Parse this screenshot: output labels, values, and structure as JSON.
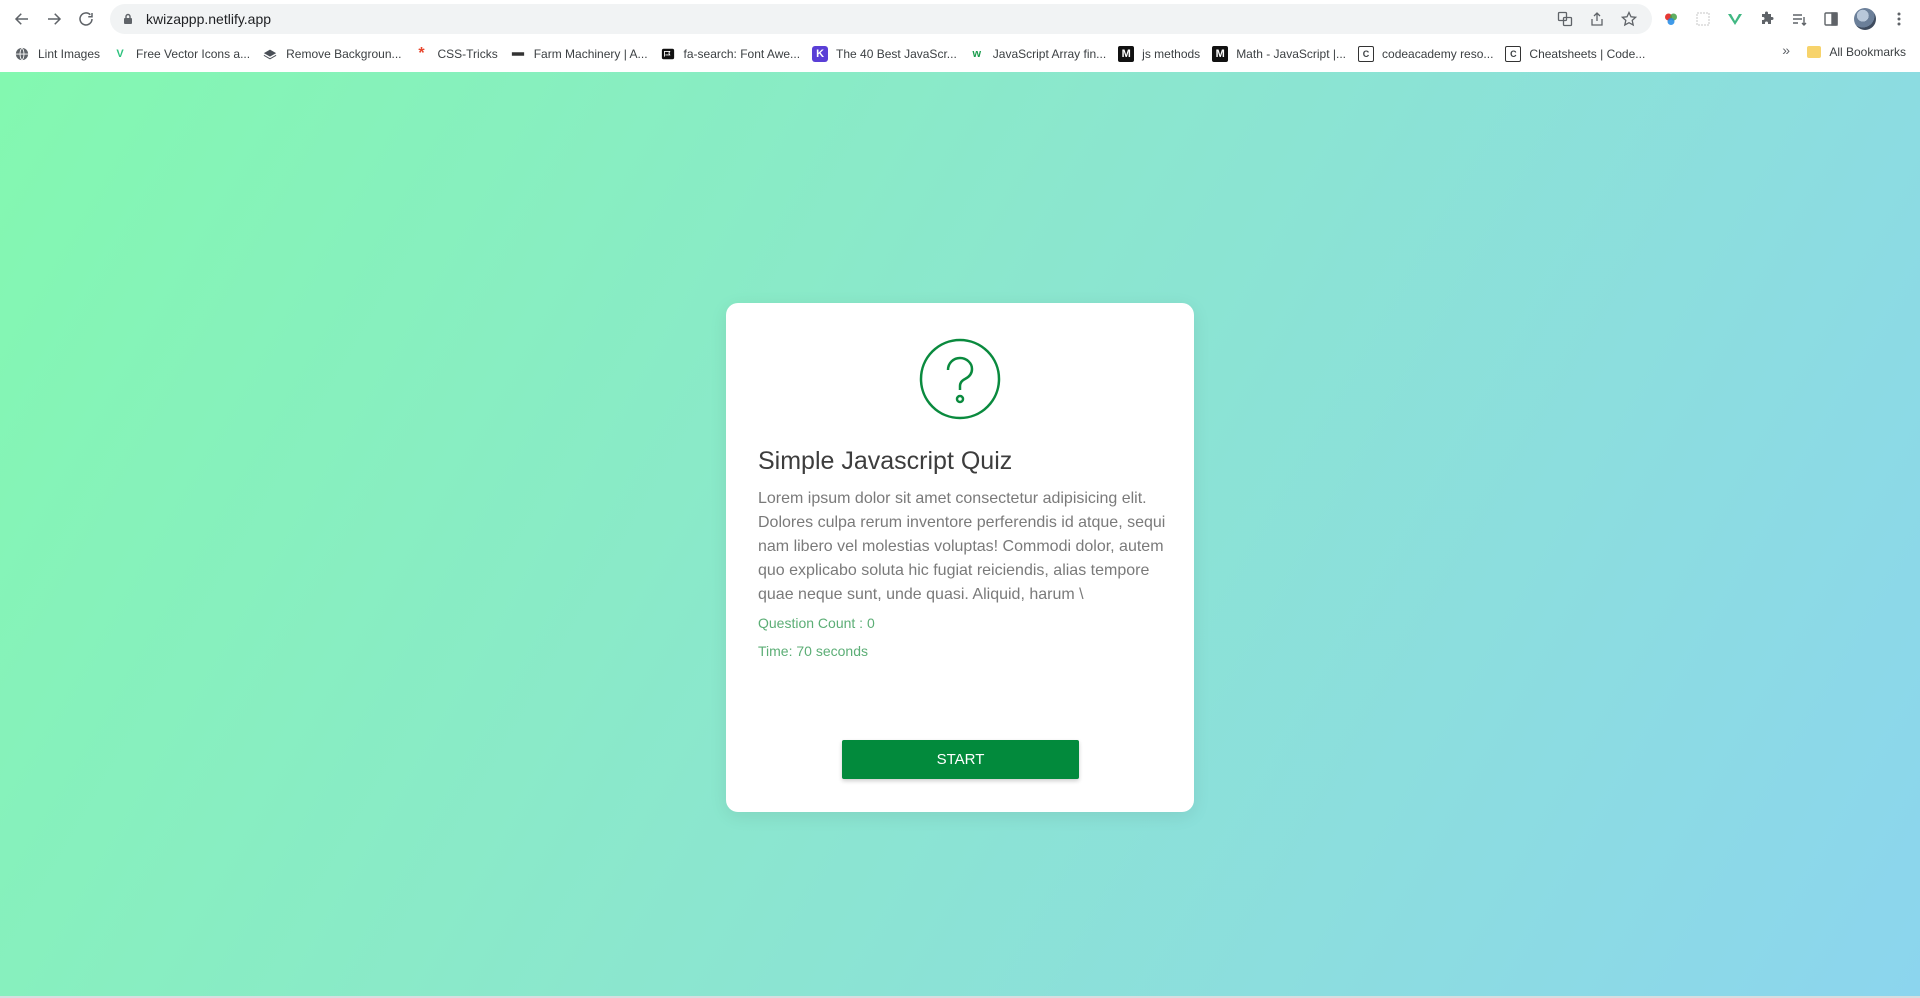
{
  "browser": {
    "url": "kwizappp.netlify.app",
    "nav": {
      "back_icon": "arrow-left-icon",
      "forward_icon": "arrow-right-icon",
      "reload_icon": "reload-icon"
    },
    "bookmarks": [
      {
        "label": "Lint Images",
        "icon": "globe-icon"
      },
      {
        "label": "Free Vector Icons a...",
        "icon": "v-logo-icon"
      },
      {
        "label": "Remove Backgroun...",
        "icon": "layers-icon"
      },
      {
        "label": "CSS-Tricks",
        "icon": "asterisk-icon"
      },
      {
        "label": "Farm Machinery | A...",
        "icon": "tractor-icon"
      },
      {
        "label": "fa-search: Font Awe...",
        "icon": "flag-icon"
      },
      {
        "label": "The 40 Best JavaScr...",
        "icon": "k-logo-icon"
      },
      {
        "label": "JavaScript Array fin...",
        "icon": "w-logo-icon"
      },
      {
        "label": "js methods",
        "icon": "m-logo-icon"
      },
      {
        "label": "Math - JavaScript |...",
        "icon": "m-logo-icon"
      },
      {
        "label": "codeacademy reso...",
        "icon": "codecademy-icon"
      },
      {
        "label": "Cheatsheets | Code...",
        "icon": "codecademy-icon"
      }
    ],
    "more_bookmarks": "»",
    "all_bookmarks": "All Bookmarks"
  },
  "quiz": {
    "title": "Simple Javascript Quiz",
    "description": "Lorem ipsum dolor sit amet consectetur adipisicing elit. Dolores culpa rerum inventore perferendis id atque, sequi nam libero vel molestias voluptas! Commodi dolor, autem quo explicabo soluta hic fugiat reiciendis, alias tempore quae neque sunt, unde quasi. Aliquid, harum \\",
    "question_count": "Question Count : 0",
    "time": "Time: 70 seconds",
    "start_label": "START",
    "icon": "question-circle-icon"
  },
  "colors": {
    "accent": "#028a3c",
    "meta_text": "#5cae76",
    "gradient_start": "#83f8b0",
    "gradient_end": "#8cd5ee"
  }
}
